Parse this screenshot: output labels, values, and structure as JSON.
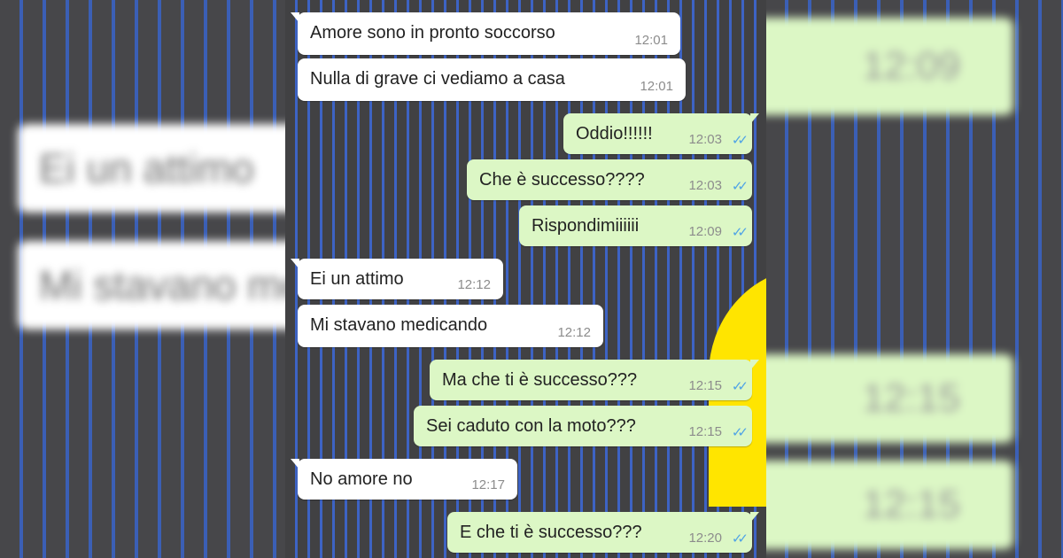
{
  "colors": {
    "incoming_bubble": "#ffffff",
    "outgoing_bubble": "#dcf7c5",
    "read_tick": "#4fa3e6",
    "wallpaper_lines": "#3d63c4",
    "sun": "#ffe500"
  },
  "messages": [
    {
      "dir": "in",
      "text": "Amore sono in pronto soccorso",
      "time": "12:01"
    },
    {
      "dir": "in",
      "text": "Nulla di grave ci vediamo a casa",
      "time": "12:01"
    },
    {
      "dir": "out",
      "text": "Oddio!!!!!!",
      "time": "12:03",
      "status": "read"
    },
    {
      "dir": "out",
      "text": "Che è successo????",
      "time": "12:03",
      "status": "read"
    },
    {
      "dir": "out",
      "text": "Rispondimiiiiii",
      "time": "12:09",
      "status": "read"
    },
    {
      "dir": "in",
      "text": "Ei un attimo",
      "time": "12:12"
    },
    {
      "dir": "in",
      "text": "Mi stavano medicando",
      "time": "12:12"
    },
    {
      "dir": "out",
      "text": "Ma che ti è successo???",
      "time": "12:15",
      "status": "read"
    },
    {
      "dir": "out",
      "text": "Sei caduto con la moto???",
      "time": "12:15",
      "status": "read"
    },
    {
      "dir": "in",
      "text": "No amore no",
      "time": "12:17"
    },
    {
      "dir": "out",
      "text": "E che ti è successo???",
      "time": "12:20",
      "status": "read"
    }
  ],
  "icons": {
    "read_status": "double-check-icon"
  }
}
